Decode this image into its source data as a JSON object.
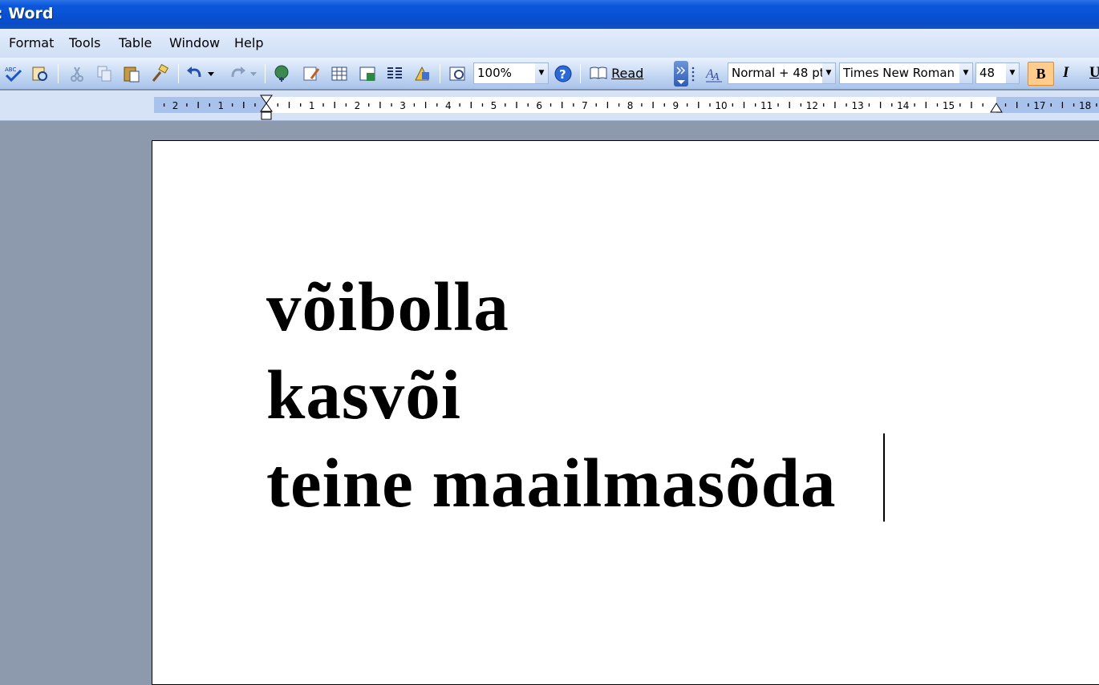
{
  "window": {
    "title": ": Word"
  },
  "menubar": {
    "items": [
      {
        "label": "Format",
        "accel": "F"
      },
      {
        "label": "Tools",
        "accel": "T"
      },
      {
        "label": "Table",
        "accel": "a"
      },
      {
        "label": "Window",
        "accel": "W"
      },
      {
        "label": "Help",
        "accel": "H"
      }
    ]
  },
  "toolbar": {
    "zoom_value": "100%",
    "read_label": "Read",
    "style_value": "Normal + 48 pt",
    "font_value": "Times New Roman",
    "size_value": "48",
    "bold_label": "B",
    "italic_label": "I",
    "underline_label": "U",
    "styles_icon_label": "A"
  },
  "ruler": {
    "labels": [
      "2",
      "1",
      "1",
      "2",
      "3",
      "4",
      "5",
      "6",
      "7",
      "8",
      "9",
      "10",
      "11",
      "12",
      "13",
      "14",
      "15",
      "17",
      "18"
    ]
  },
  "document": {
    "lines": [
      "võibolla",
      "kasvõi",
      "teine maailmasõda"
    ]
  },
  "colors": {
    "titlebar": "#0750d2",
    "workspace": "#8d99ad",
    "bold_active": "#ffcc8c"
  }
}
